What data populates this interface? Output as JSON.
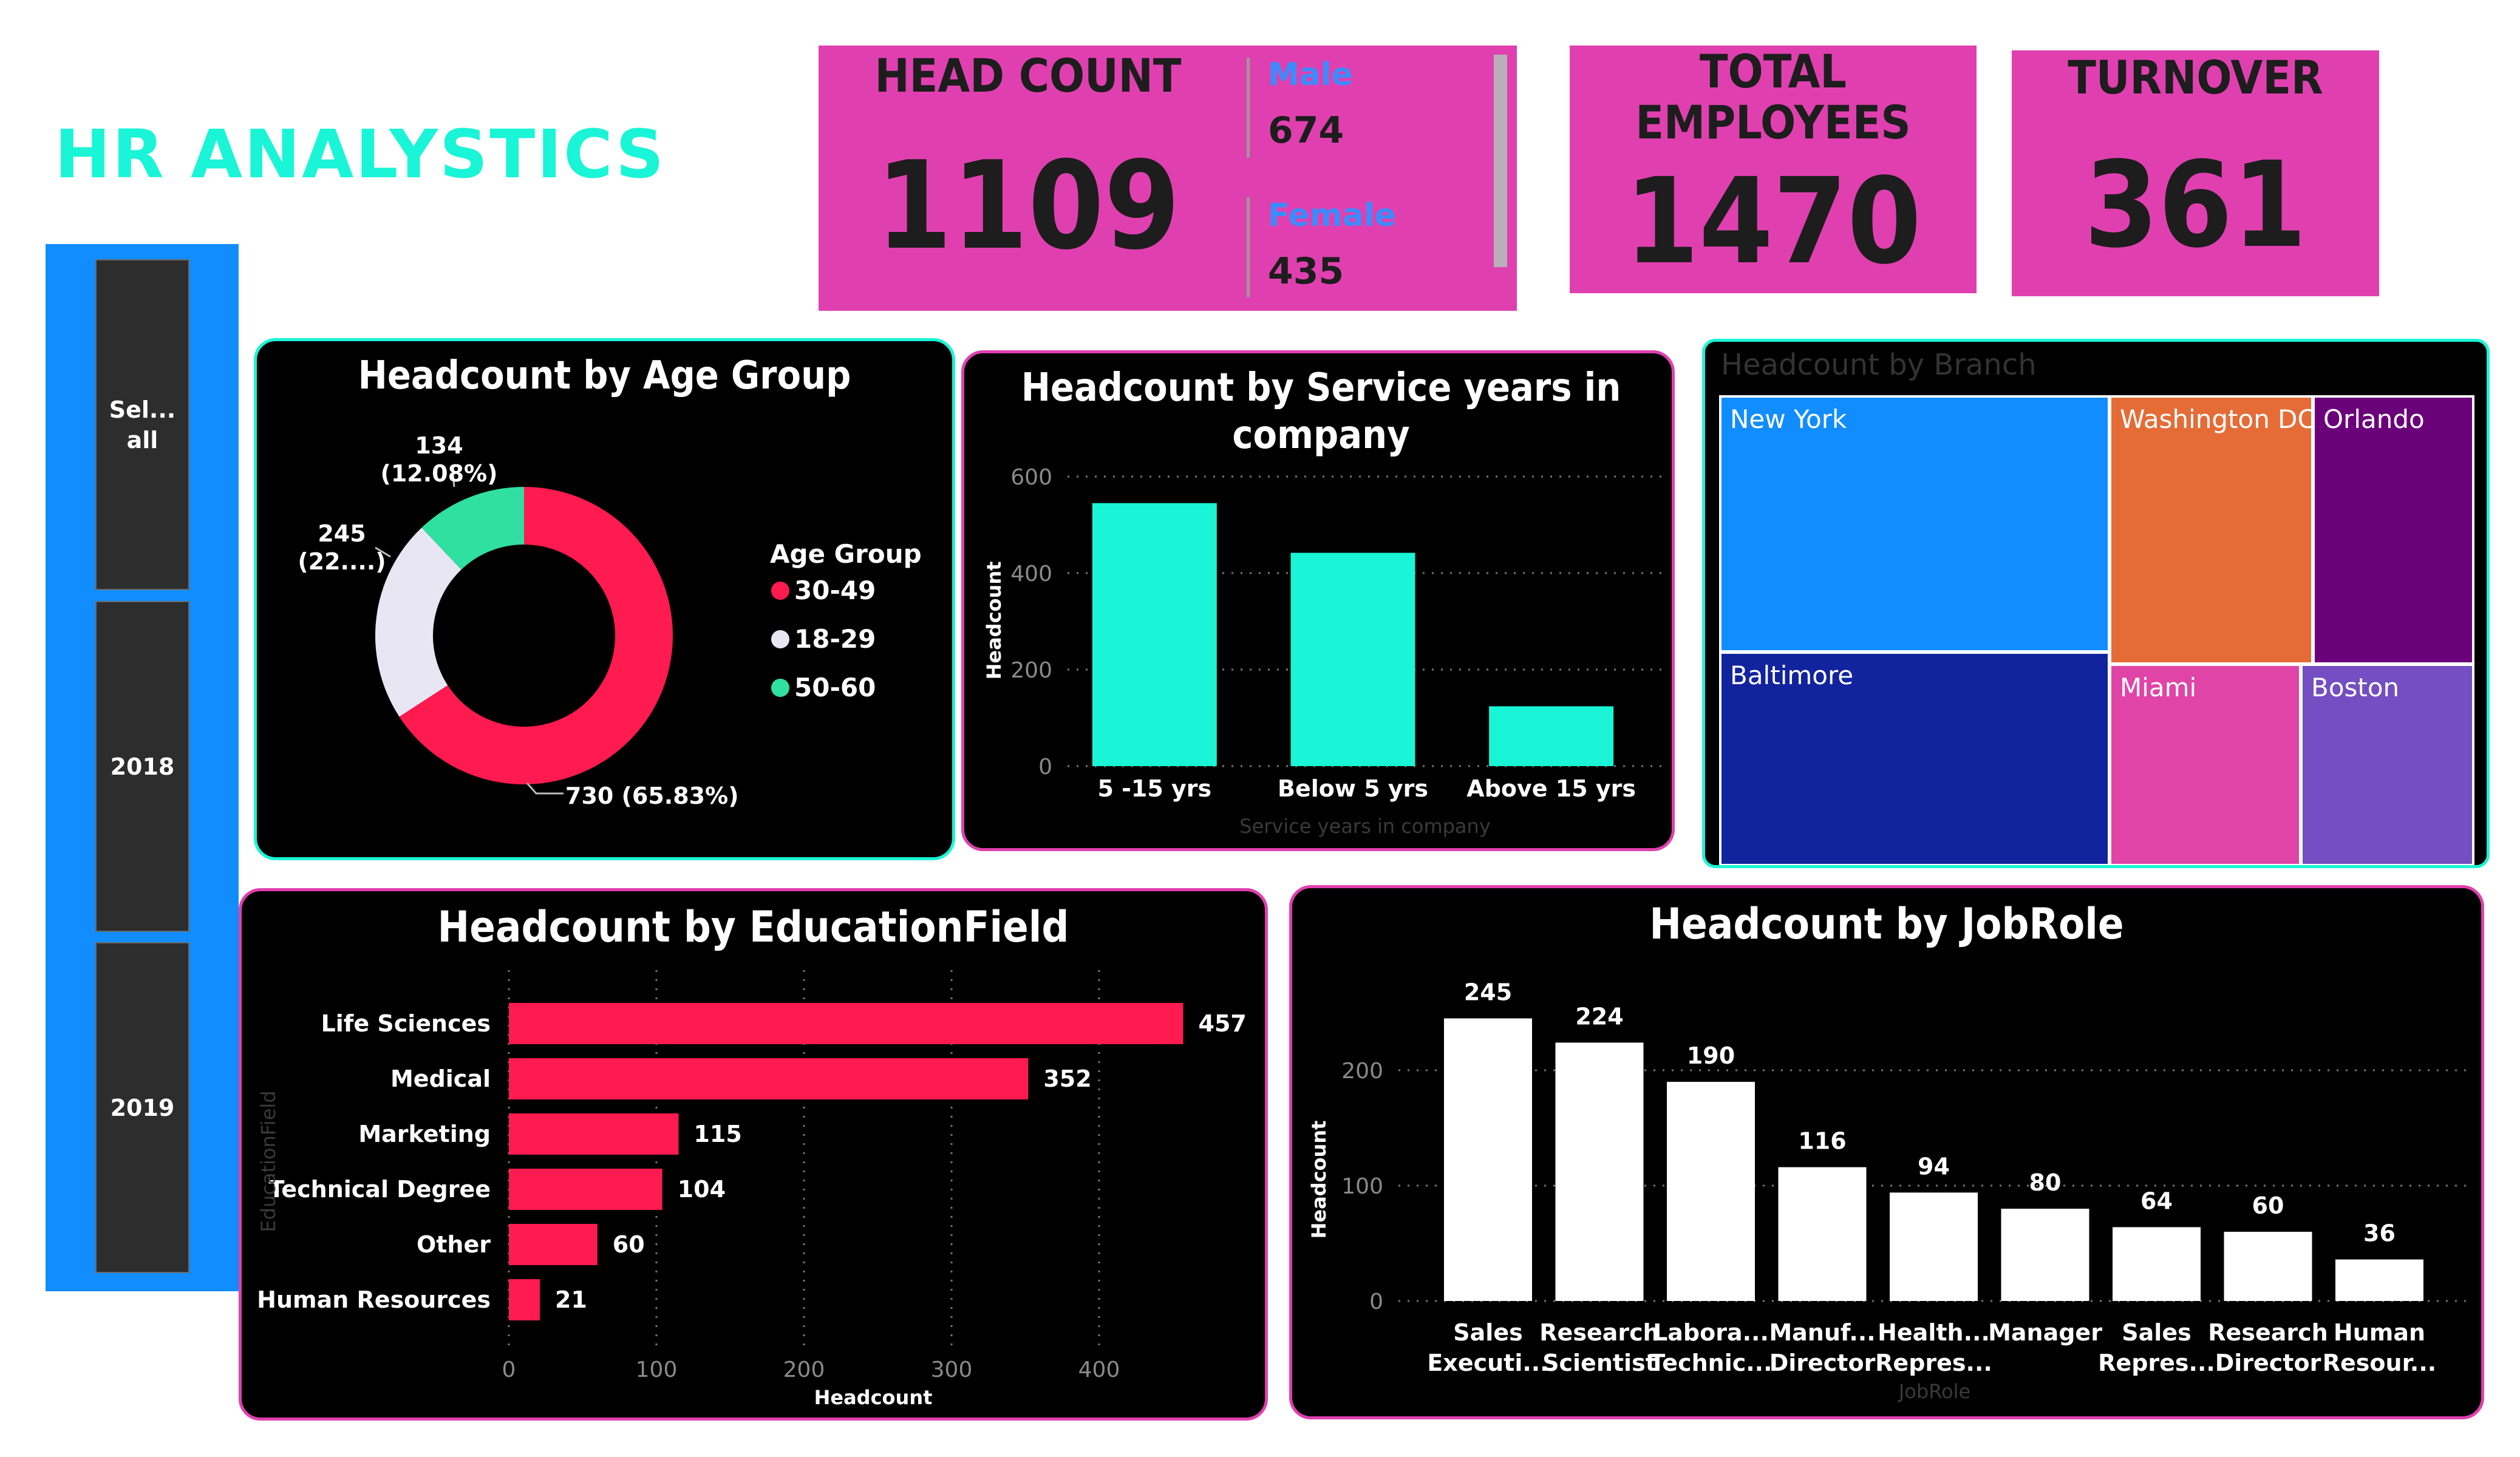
{
  "dashboard": {
    "title": "HR ANALYSTICS"
  },
  "slicer": {
    "items": [
      "Sel...\nall",
      "2018",
      "2019"
    ]
  },
  "kpis": {
    "head_count": {
      "label": "HEAD COUNT",
      "value": "1109",
      "male_label": "Male",
      "male_value": "674",
      "female_label": "Female",
      "female_value": "435"
    },
    "total_employees": {
      "label_line1": "TOTAL",
      "label_line2": "EMPLOYEES",
      "value": "1470"
    },
    "turnover": {
      "label": "TURNOVER",
      "value": "361"
    }
  },
  "colors": {
    "accent_pink": "#e040af",
    "teal": "#19f5d6",
    "red": "#ff1a4f",
    "blue_panel": "#118dff"
  },
  "chart_data": [
    {
      "type": "pie",
      "title": "Headcount by Age Group",
      "legend_title": "Age Group",
      "legend_position": "right",
      "categories": [
        "30-49",
        "18-29",
        "50-60"
      ],
      "values": [
        730,
        245,
        134
      ],
      "data_labels": [
        "730 (65.83%)",
        "245\n(22....)",
        "134\n(12.08%)"
      ],
      "colors": [
        "#ff1a4f",
        "#e9e6f4",
        "#2fe0a0"
      ]
    },
    {
      "type": "bar",
      "title": "Headcount by Service years in company",
      "categories": [
        "5 -15 yrs",
        "Below 5 yrs",
        "Above 15 yrs"
      ],
      "values": [
        545,
        442,
        124
      ],
      "xlabel": "Service years in company",
      "ylabel": "Headcount",
      "ylim": [
        0,
        600
      ],
      "yticks": [
        "0",
        "200",
        "400",
        "600"
      ],
      "grid": true,
      "color": "#19f5d6"
    },
    {
      "type": "treemap",
      "title": "Headcount by Branch",
      "categories": [
        "New York",
        "Baltimore",
        "Washington DC",
        "Orlando",
        "Miami",
        "Boston"
      ],
      "colors": [
        "#118dff",
        "#12239e",
        "#e66c37",
        "#6b007b",
        "#e044a7",
        "#744ec2"
      ]
    },
    {
      "type": "bar",
      "orientation": "horizontal",
      "title": "Headcount by EducationField",
      "categories": [
        "Life Sciences",
        "Medical",
        "Marketing",
        "Technical Degree",
        "Other",
        "Human Resources"
      ],
      "values": [
        457,
        352,
        115,
        104,
        60,
        21
      ],
      "xlabel": "Headcount",
      "ylabel": "EducationField",
      "xlim": [
        0,
        470
      ],
      "xticks": [
        "0",
        "100",
        "200",
        "300",
        "400"
      ],
      "grid": true,
      "color": "#ff1a4f"
    },
    {
      "type": "bar",
      "title": "Headcount by JobRole",
      "categories": [
        "Sales\nExecuti...",
        "Research\nScientist",
        "Labora...\nTechnic...",
        "Manuf...\nDirector",
        "Health...\nRepres...",
        "Manager",
        "Sales\nRepres...",
        "Research\nDirector",
        "Human\nResour..."
      ],
      "values": [
        245,
        224,
        190,
        116,
        94,
        80,
        64,
        60,
        36
      ],
      "xlabel": "JobRole",
      "ylabel": "Headcount",
      "ylim": [
        0,
        245
      ],
      "yticks": [
        "0",
        "100",
        "200"
      ],
      "grid": true,
      "color": "#ffffff"
    }
  ]
}
